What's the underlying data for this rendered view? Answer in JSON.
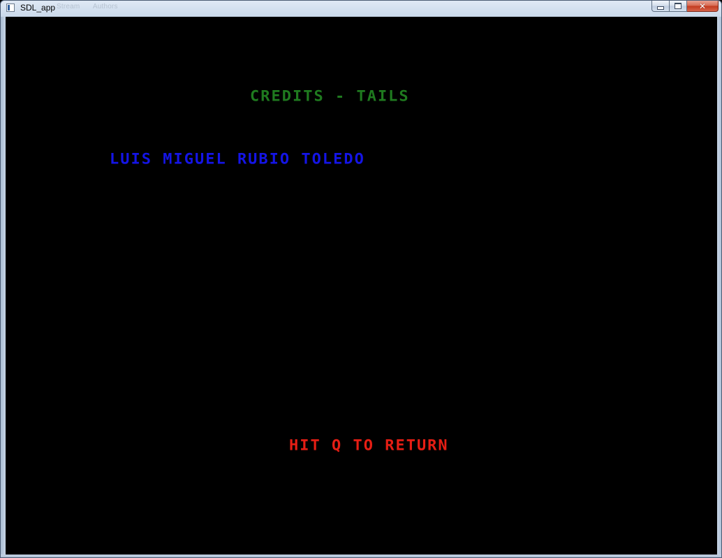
{
  "window": {
    "title": "SDL_app",
    "toolbar_ghost": [
      "Stream",
      "Authors"
    ]
  },
  "screen": {
    "title": "CREDITS - TAILS",
    "credits": [
      "LUIS MIGUEL RUBIO TOLEDO"
    ],
    "hint": "HIT Q TO RETURN"
  },
  "colors": {
    "background": "#000000",
    "title": "#1f7a1f",
    "credit_name": "#1414e6",
    "hint": "#e61e14"
  },
  "icons": {
    "app": "app-window-icon",
    "minimize": "minimize-icon",
    "maximize": "maximize-icon",
    "close": "close-icon"
  }
}
